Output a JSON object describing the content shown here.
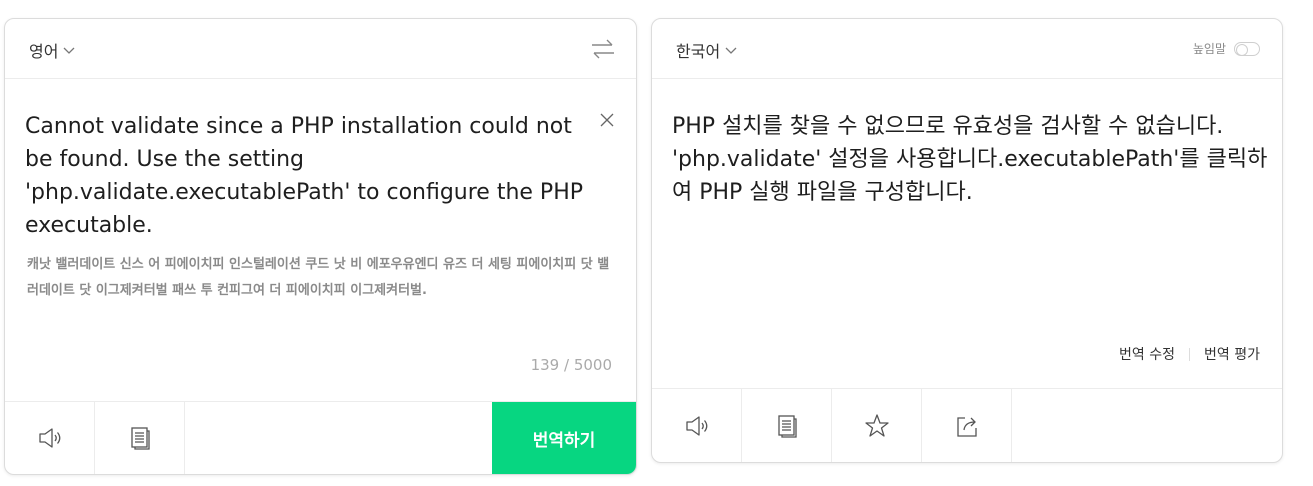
{
  "source": {
    "language": "영어",
    "text": "Cannot validate since a PHP installation could not be found. Use the setting 'php.validate.executablePath' to configure the PHP executable.",
    "pronunciation": "캐낫 밸러데이트 신스 어 피에이치피 인스털레이션 쿠드 낫 비 에포우유엔디 유즈 더 세팅 피에이치피 닷 밸러데이트 닷 이그제켜터벌 패쓰 투 컨피그여 더 피에이치피 이그제켜터벌.",
    "char_count": "139 / 5000",
    "translate_label": "번역하기",
    "icons": [
      "swap-icon",
      "close-icon",
      "speaker-icon",
      "copy-icon"
    ]
  },
  "target": {
    "language": "한국어",
    "honorific_label": "높임말",
    "honorific_on": false,
    "text": "PHP 설치를 찾을 수 없으므로 유효성을 검사할 수 없습니다. 'php.validate' 설정을 사용합니다.executablePath'를 클릭하여 PHP 실행 파일을 구성합니다.",
    "edit_label": "번역 수정",
    "rate_label": "번역 평가",
    "icons": [
      "speaker-icon",
      "copy-icon",
      "star-icon",
      "share-icon"
    ]
  },
  "colors": {
    "accent": "#07d681",
    "muted_text": "#8a8a8a",
    "border": "#dcdcdc"
  }
}
